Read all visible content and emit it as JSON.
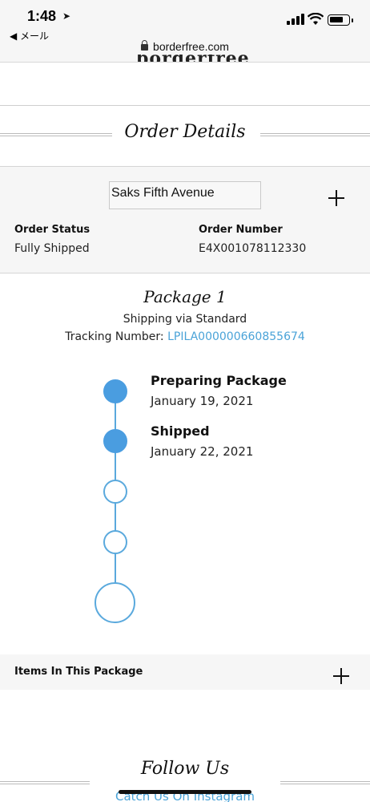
{
  "status_bar": {
    "time": "1:48",
    "back_app": "◀ メール"
  },
  "browser": {
    "url": "borderfree.com"
  },
  "page": {
    "section_title": "Order Details",
    "store_name": "Saks Fifth Avenue",
    "order_status_label": "Order Status",
    "order_status_value": "Fully Shipped",
    "order_number_label": "Order Number",
    "order_number_value": "E4X001078112330"
  },
  "package": {
    "title": "Package 1",
    "shipping_text": "Shipping via Standard",
    "tracking_label": "Tracking Number: ",
    "tracking_number": "LPILA000000660855674"
  },
  "timeline": {
    "steps": [
      {
        "title": "Preparing Package",
        "date": "January 19, 2021",
        "completed": true
      },
      {
        "title": "Shipped",
        "date": "January 22, 2021",
        "completed": true
      },
      {
        "title": "",
        "date": "",
        "completed": false
      },
      {
        "title": "",
        "date": "",
        "completed": false
      },
      {
        "title": "",
        "date": "",
        "completed": false
      }
    ]
  },
  "items_panel": {
    "label": "Items In This Package"
  },
  "footer": {
    "follow_title": "Follow Us",
    "instagram_link": "Catch Us On Instagram"
  },
  "colors": {
    "accent": "#4a9de0",
    "link": "#4aa3d8"
  }
}
